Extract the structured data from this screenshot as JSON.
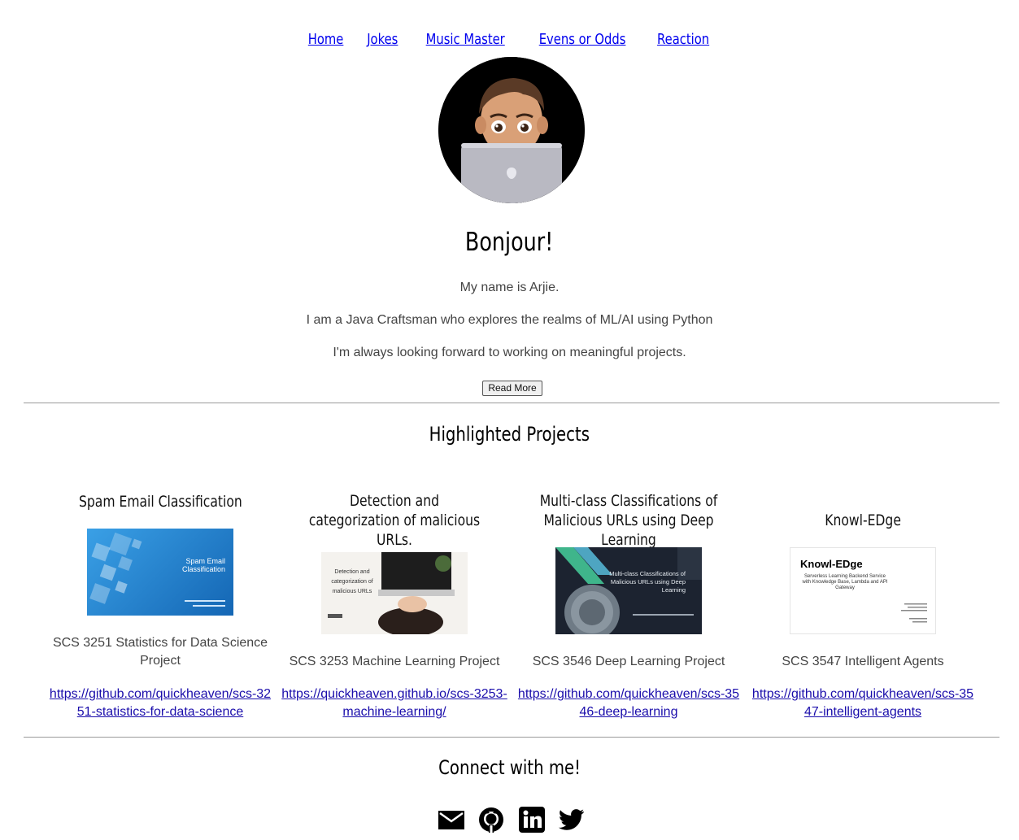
{
  "nav": {
    "items": [
      {
        "label": "Home"
      },
      {
        "label": "Jokes"
      },
      {
        "label": "Music Master"
      },
      {
        "label": "Evens or Odds"
      },
      {
        "label": "Reaction"
      }
    ]
  },
  "hero": {
    "greeting": "Bonjour!",
    "lines": [
      "My name is Arjie.",
      "I am a Java Craftsman who explores the realms of ML/AI using Python",
      "I'm always looking forward to working on meaningful projects."
    ],
    "read_more": "Read More"
  },
  "projects": {
    "heading": "Highlighted Projects",
    "items": [
      {
        "title": "Spam Email Classification",
        "thumb_text": "Spam Email Classification",
        "description": "SCS 3251 Statistics for Data Science Project",
        "link": "https://github.com/quickheaven/scs-3251-statistics-for-data-science"
      },
      {
        "title": "Detection and categorization of malicious URLs.",
        "thumb_text": "Detection and categorization of malicious URLs",
        "description": "SCS 3253 Machine Learning Project",
        "link": "https://quickheaven.github.io/scs-3253-machine-learning/"
      },
      {
        "title": "Multi-class Classifications of Malicious URLs using Deep Learning",
        "thumb_text": "Multi-class Classifications of Malicious URLs using Deep Learning",
        "description": "SCS 3546 Deep Learning Project",
        "link": "https://github.com/quickheaven/scs-3546-deep-learning"
      },
      {
        "title": "Knowl-EDge",
        "thumb_text": "Knowl-EDge",
        "thumb_sub": "Serverless Learning Backend Service with Knowledge Base, Lambda and API Gateway",
        "description": "SCS 3547 Intelligent Agents",
        "link": "https://github.com/quickheaven/scs-3547-intelligent-agents"
      }
    ]
  },
  "connect": {
    "heading": "Connect with me!",
    "icons": [
      "email-icon",
      "github-icon",
      "linkedin-icon",
      "twitter-icon"
    ]
  },
  "colors": {
    "link": "#0000ee",
    "text_light": "#444444",
    "thumb_blue": "#1f78c8",
    "thumb_dark": "#1c2330"
  }
}
